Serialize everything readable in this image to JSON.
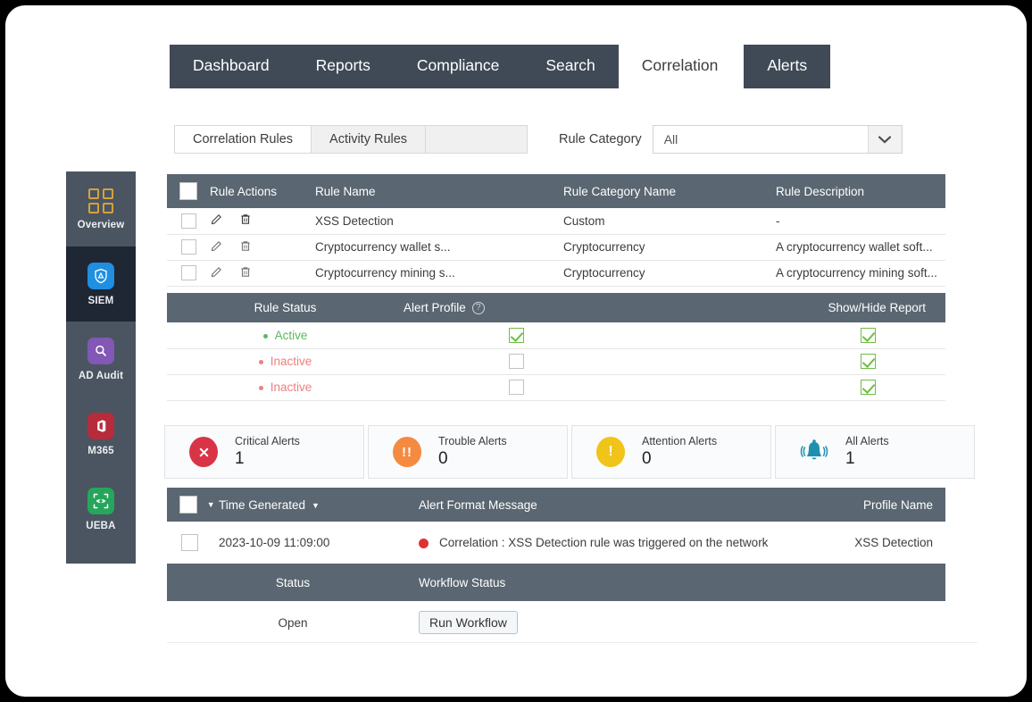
{
  "nav": {
    "items": [
      {
        "label": "Dashboard",
        "active": false
      },
      {
        "label": "Reports",
        "active": false
      },
      {
        "label": "Compliance",
        "active": false
      },
      {
        "label": "Search",
        "active": false
      },
      {
        "label": "Correlation",
        "active": true
      }
    ],
    "standalone": {
      "label": "Alerts"
    }
  },
  "sidebar": {
    "items": [
      {
        "label": "Overview",
        "icon": "grid-icon",
        "color": "#d6a13c",
        "active": false
      },
      {
        "label": "SIEM",
        "icon": "shield-icon",
        "color": "#1e8fe1",
        "active": true
      },
      {
        "label": "AD Audit",
        "icon": "search-icon",
        "color": "#8257b5",
        "active": false
      },
      {
        "label": "M365",
        "icon": "office-icon",
        "color": "#b62c3c",
        "active": false
      },
      {
        "label": "UEBA",
        "icon": "eye-icon",
        "color": "#26a65b",
        "active": false
      }
    ]
  },
  "subtabs": [
    {
      "label": "Correlation Rules",
      "active": true
    },
    {
      "label": "Activity Rules",
      "active": false
    }
  ],
  "filter": {
    "label": "Rule Category",
    "value": "All",
    "options": [
      "All"
    ]
  },
  "rules_table": {
    "columns": [
      "",
      "Rule Actions",
      "Rule Name",
      "Rule Category Name",
      "Rule Description"
    ],
    "rows": [
      {
        "selected": false,
        "rule_name": "XSS Detection",
        "rule_category_name": "Custom",
        "rule_description": "-"
      },
      {
        "selected": false,
        "rule_name": "Cryptocurrency wallet s...",
        "rule_category_name": "Cryptocurrency",
        "rule_description": "A cryptocurrency wallet soft..."
      },
      {
        "selected": false,
        "rule_name": "Cryptocurrency mining s...",
        "rule_category_name": "Cryptocurrency",
        "rule_description": "A cryptocurrency mining soft..."
      }
    ]
  },
  "status_table": {
    "columns": [
      "Rule Status",
      "Alert Profile",
      "Show/Hide Report"
    ],
    "rows": [
      {
        "rule_status": "Active",
        "status_type": "active",
        "alert_profile": true,
        "show_hide_report": true
      },
      {
        "rule_status": "Inactive",
        "status_type": "inactive",
        "alert_profile": false,
        "show_hide_report": true
      },
      {
        "rule_status": "Inactive",
        "status_type": "inactive",
        "alert_profile": false,
        "show_hide_report": true
      }
    ]
  },
  "alert_cards": [
    {
      "title": "Critical Alerts",
      "value": "1",
      "icon": "x-circle-icon",
      "color": "#d93446"
    },
    {
      "title": "Trouble Alerts",
      "value": "0",
      "icon": "double-exclamation-icon",
      "color": "#f58a41"
    },
    {
      "title": "Attention Alerts",
      "value": "0",
      "icon": "exclamation-icon",
      "color": "#f0c419"
    },
    {
      "title": "All Alerts",
      "value": "1",
      "icon": "bell-icon",
      "color": "#1f8fae"
    }
  ],
  "alerts_table": {
    "columns": [
      "",
      "Time Generated",
      "Alert Format Message",
      "Profile Name"
    ],
    "sort_column": "Time Generated",
    "rows": [
      {
        "selected": false,
        "time_generated": "2023-10-09 11:09:00",
        "alert_format_message": "Correlation : XSS Detection rule was triggered on the network",
        "severity_color": "#e03131",
        "profile_name": "XSS Detection"
      }
    ]
  },
  "workflow_table": {
    "columns": [
      "Status",
      "Workflow Status"
    ],
    "rows": [
      {
        "status": "Open",
        "workflow_button": "Run Workflow"
      }
    ]
  }
}
